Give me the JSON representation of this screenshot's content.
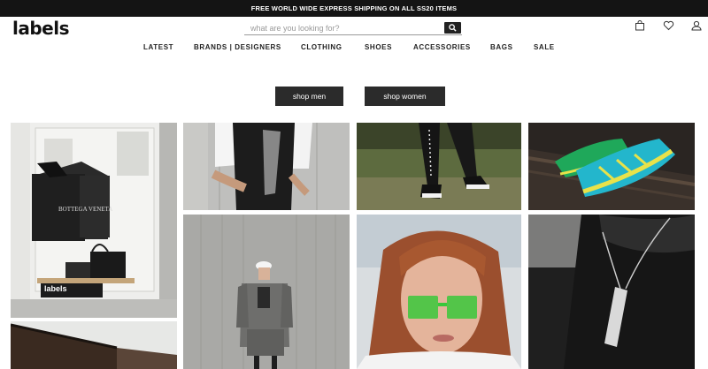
{
  "announcement": "FREE WORLD WIDE EXPRESS SHIPPING ON ALL SS20 ITEMS",
  "brand": {
    "logo_text": "labels"
  },
  "search": {
    "placeholder": "what are you looking for?"
  },
  "header_icons": [
    "bag-icon",
    "heart-icon",
    "user-icon"
  ],
  "nav": [
    "LATEST",
    "BRANDS | DESIGNERS",
    "CLOTHING",
    "SHOES",
    "ACCESSORIES",
    "BAGS",
    "SALE"
  ],
  "cta": {
    "men": "shop men",
    "women": "shop women"
  },
  "store_window": {
    "sign": "BOTTEGA VENETA",
    "stand_logo": "labels"
  },
  "colors": {
    "topbar": "#141414",
    "cta": "#2b2b2b",
    "sneaker": "#23b6cc",
    "sneaker_accent": "#e8e24a",
    "glasses": "#39c83b"
  }
}
